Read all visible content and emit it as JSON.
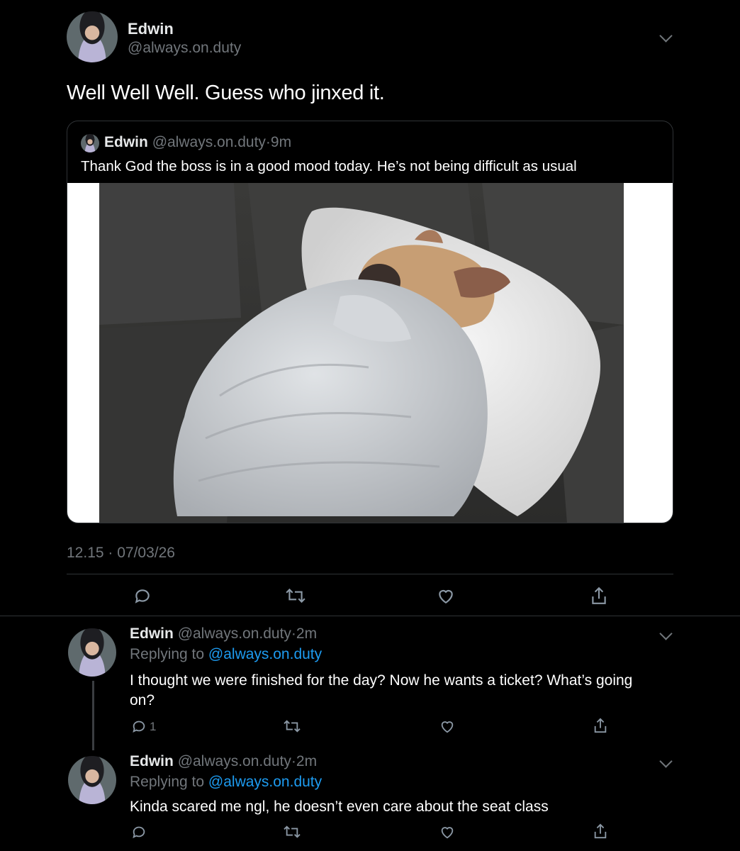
{
  "main_tweet": {
    "name": "Edwin",
    "handle": "@always.on.duty",
    "text": "Well Well Well. Guess who jinxed it.",
    "timestamp": "12.15 · 07/03/26",
    "quoted": {
      "name": "Edwin",
      "handle": "@always.on.duty",
      "time": "·9m",
      "text": "Thank God the boss is in a good mood today. He’s not being difficult as usual",
      "image_alt": "French bulldog wrapped in a quilted blanket sleeping on a pillow on a gray couch"
    }
  },
  "replies": [
    {
      "name": "Edwin",
      "handle": "@always.on.duty",
      "time": "·2m",
      "replying_label": "Replying to",
      "replying_to": "@always.on.duty",
      "text_line1": "I thought we were finished for the day? Now he wants a ticket? What’s going",
      "text_line2": "on?",
      "reply_count": "1"
    },
    {
      "name": "Edwin",
      "handle": "@always.on.duty",
      "time": "·2m",
      "replying_label": "Replying to",
      "replying_to": "@always.on.duty",
      "text_line1": "Kinda scared me ngl, he doesn’t even care about the seat class",
      "reply_count": ""
    }
  ],
  "icons": [
    "chevron-down-icon",
    "reply-icon",
    "retweet-icon",
    "like-icon",
    "share-icon"
  ],
  "colors": {
    "background": "#000000",
    "text": "#e7e9ea",
    "muted": "#71767b",
    "link": "#1d9bf0",
    "divider": "#2f3336"
  }
}
